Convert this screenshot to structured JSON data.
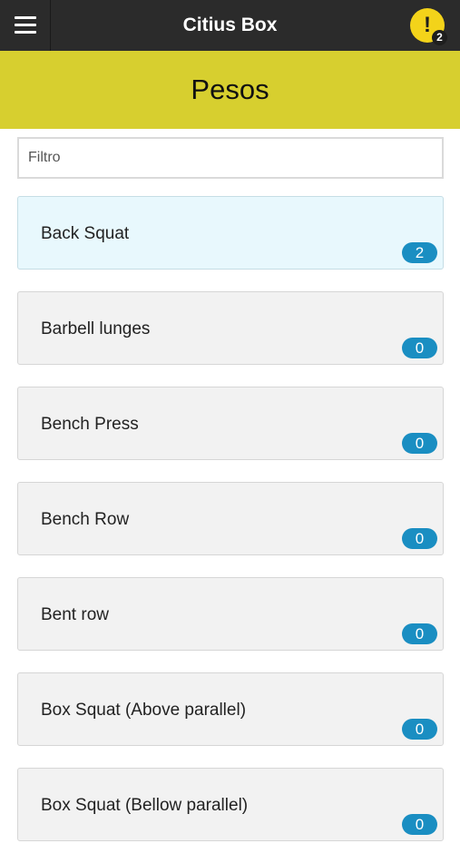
{
  "header": {
    "title": "Citius Box",
    "notifications_count": "2",
    "alert_symbol": "!"
  },
  "section": {
    "title": "Pesos"
  },
  "filter": {
    "placeholder": "Filtro",
    "value": ""
  },
  "exercises": [
    {
      "name": "Back Squat",
      "count": "2",
      "active": true
    },
    {
      "name": "Barbell lunges",
      "count": "0",
      "active": false
    },
    {
      "name": "Bench Press",
      "count": "0",
      "active": false
    },
    {
      "name": "Bench Row",
      "count": "0",
      "active": false
    },
    {
      "name": "Bent row",
      "count": "0",
      "active": false
    },
    {
      "name": "Box Squat (Above parallel)",
      "count": "0",
      "active": false
    },
    {
      "name": "Box Squat (Bellow parallel)",
      "count": "0",
      "active": false
    }
  ],
  "colors": {
    "header_bg": "#2b2b2b",
    "banner_bg": "#d7cf2f",
    "alert_bg": "#f3d31a",
    "badge_bg": "#1a8ec2",
    "active_item_bg": "#e8f8fd"
  },
  "icons": {
    "menu": "hamburger-menu-icon",
    "alert": "exclamation-alert-icon"
  }
}
